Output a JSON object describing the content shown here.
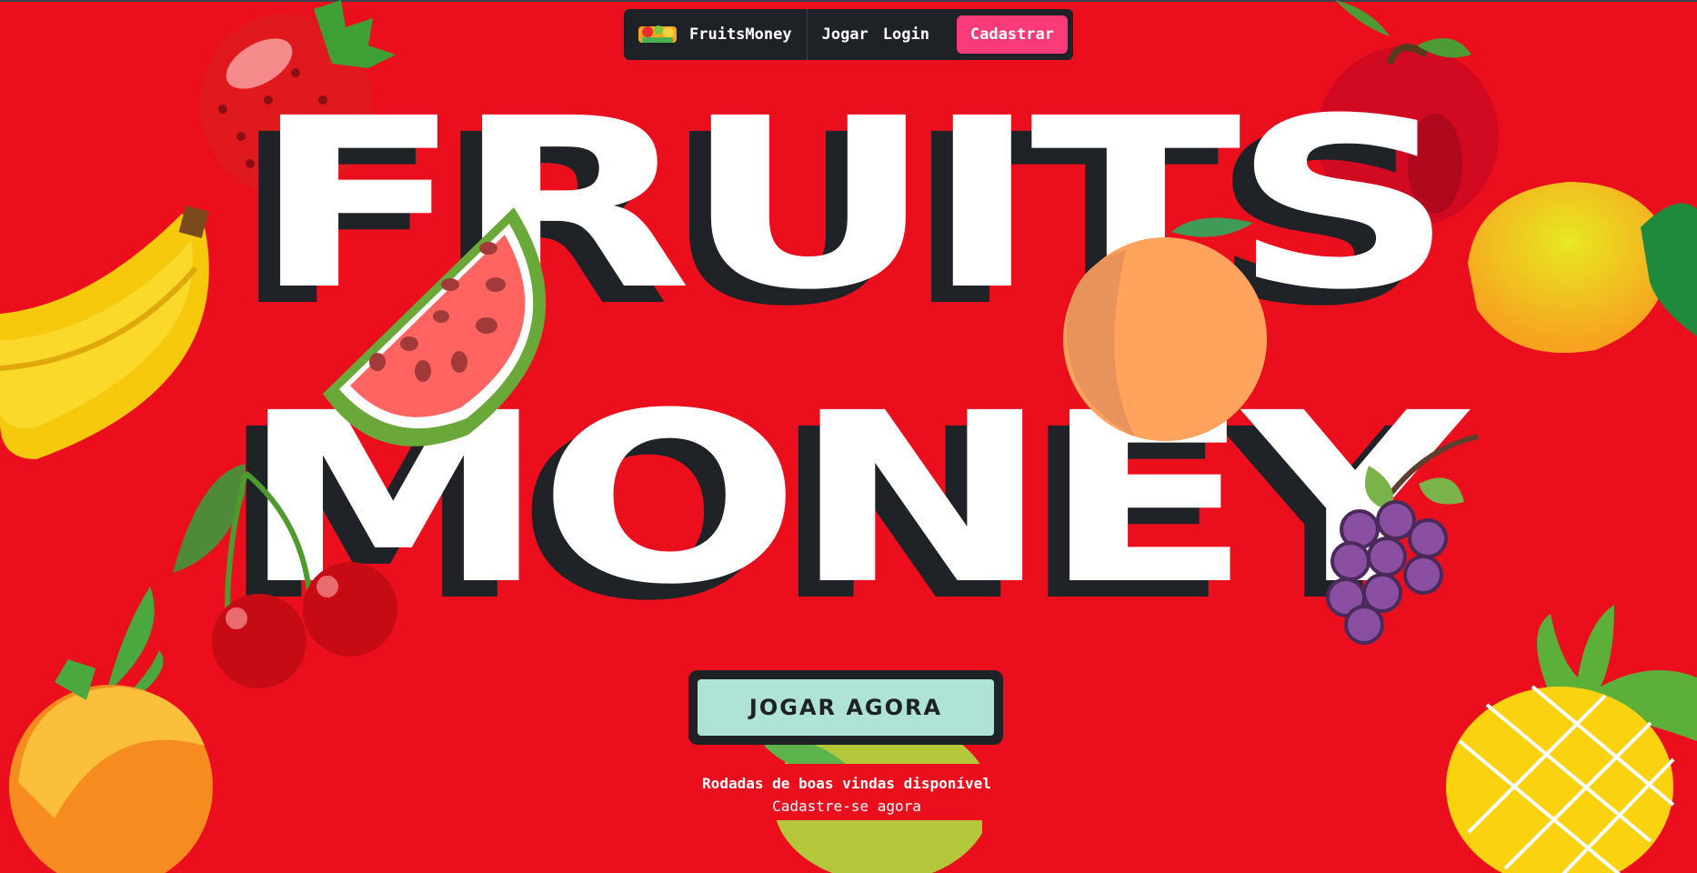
{
  "nav": {
    "brand_name": "FruitsMoney",
    "links": [
      "Jogar",
      "Login"
    ],
    "signup_label": "Cadastrar"
  },
  "hero": {
    "line1": "FRUITS",
    "line2": "MONEY",
    "cta_label": "JOGAR AGORA",
    "subtitle_bold": "Rodadas de boas vindas disponível",
    "subtitle_link": "Cadastre-se agora"
  },
  "colors": {
    "background": "#eb0f1e",
    "nav_bg": "#1e2126",
    "signup_bg": "#fb3a7a",
    "cta_bg": "#aee3d6",
    "title_shadow": "#1f2328"
  },
  "icons": [
    "brand-logo-icon",
    "strawberry-icon",
    "banana-icon",
    "watermelon-icon",
    "cherry-icon",
    "orange-icon",
    "apple-icon",
    "peach-icon",
    "mango-icon",
    "grapes-icon",
    "pineapple-icon",
    "lime-icon"
  ]
}
